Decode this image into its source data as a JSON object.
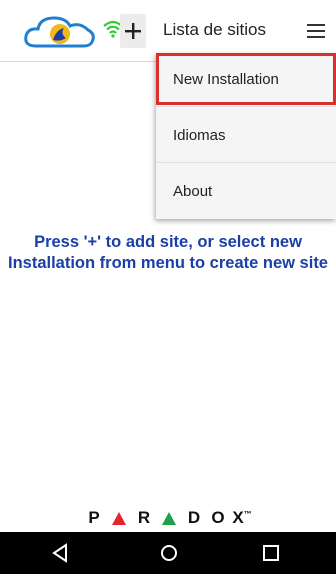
{
  "header": {
    "title": "Lista de sitios",
    "icons": {
      "logo": "swan-cloud-logo-icon",
      "wifi": "wifi-icon",
      "add": "plus-icon",
      "menu": "hamburger-icon"
    },
    "add_label": "+"
  },
  "menu": {
    "items": [
      {
        "label": "New Installation",
        "highlighted": true
      },
      {
        "label": "Idiomas",
        "highlighted": false
      },
      {
        "label": "About",
        "highlighted": false
      }
    ]
  },
  "message": "Press '+' to add site, or select new Installation from menu to create new site",
  "brand": {
    "letters": [
      "P",
      "R",
      "D",
      "O",
      "X"
    ],
    "trademark": "™"
  },
  "navbar": {
    "icons": [
      "back-icon",
      "home-icon",
      "recent-apps-icon"
    ]
  },
  "colors": {
    "message": "#1a3fa6",
    "highlight": "#d9302c",
    "wifi": "#33cc33",
    "brand_red": "#e3262b",
    "brand_green": "#1aa34a"
  }
}
